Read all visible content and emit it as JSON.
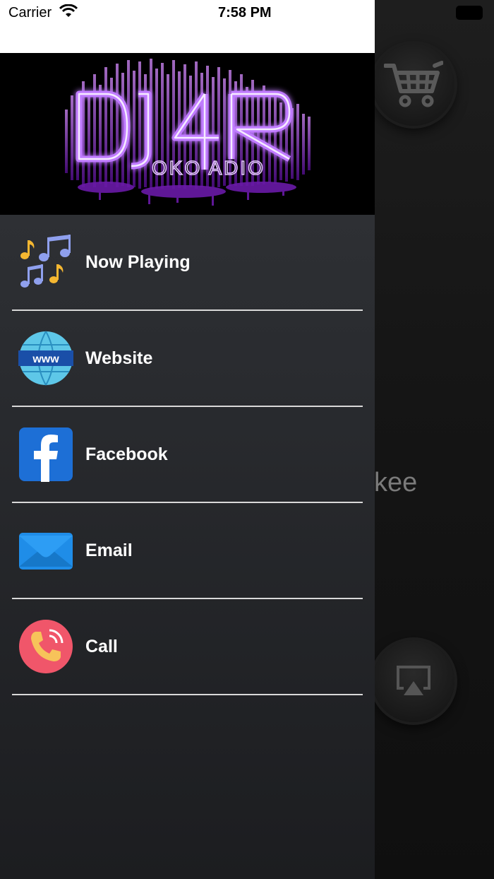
{
  "status_bar": {
    "carrier": "Carrier",
    "time": "7:58 PM"
  },
  "banner": {
    "logo_letters": "DJ4R",
    "logo_subtitle": "OKO ADIO",
    "accent_color": "#a63cf0"
  },
  "menu": {
    "items": [
      {
        "label": "Now Playing",
        "icon": "music-notes-icon"
      },
      {
        "label": "Website",
        "icon": "www-globe-icon"
      },
      {
        "label": "Facebook",
        "icon": "facebook-icon"
      },
      {
        "label": "Email",
        "icon": "email-icon"
      },
      {
        "label": "Call",
        "icon": "phone-call-icon"
      }
    ]
  },
  "background_screen": {
    "partial_text": "kee",
    "cart_icon": "cart-icon",
    "airplay_icon": "airplay-icon"
  }
}
